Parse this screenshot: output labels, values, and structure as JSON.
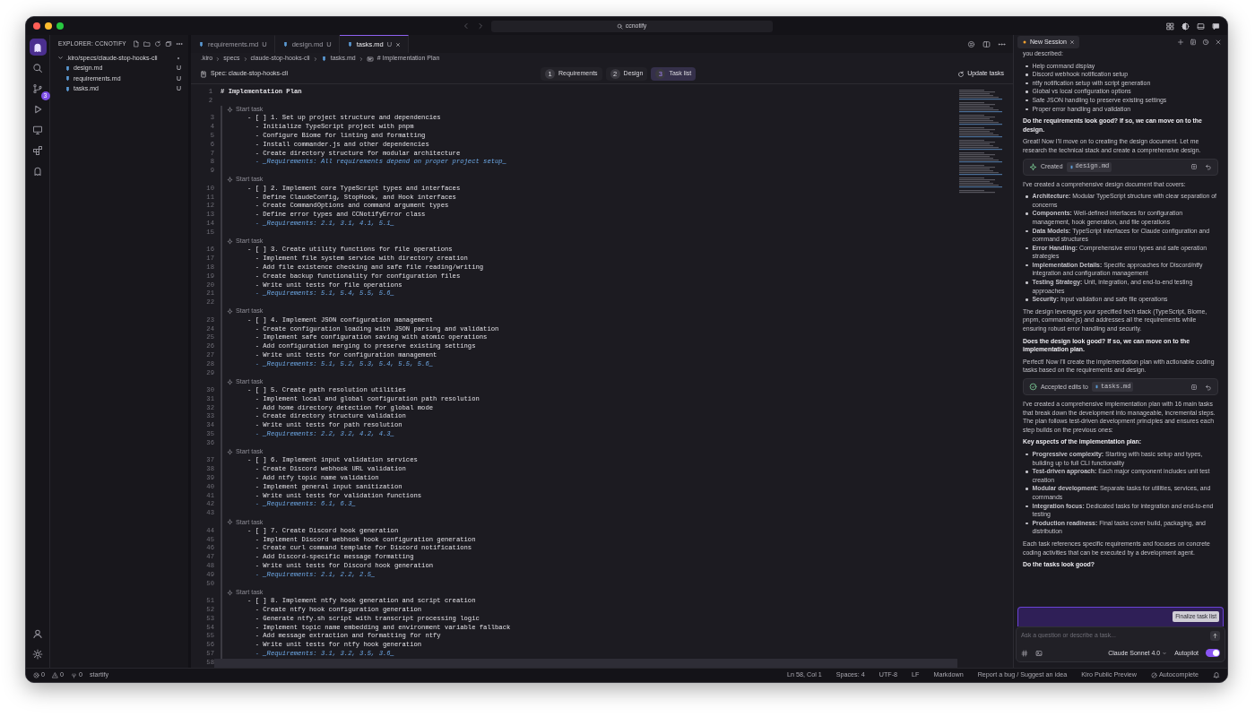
{
  "title_bar": {
    "search": "ccnotify"
  },
  "activity_bar": {
    "top": [
      {
        "kind": "logo",
        "selected": true
      },
      {
        "kind": "search",
        "selected": false
      },
      {
        "kind": "scm",
        "selected": false,
        "badge": "3"
      },
      {
        "kind": "run",
        "selected": false
      },
      {
        "kind": "remote",
        "selected": false
      },
      {
        "kind": "extensions",
        "selected": false
      },
      {
        "kind": "ghost",
        "selected": false
      }
    ],
    "bottom": [
      {
        "kind": "account",
        "selected": false
      },
      {
        "kind": "settings",
        "selected": false
      }
    ]
  },
  "explorer": {
    "title": "EXPLORER: CCNOTIFY",
    "tree": [
      {
        "label": ".kiro/specs/claude-stop-hooks-cli",
        "expanded": true,
        "changed": true,
        "children": [
          {
            "label": "design.md",
            "status": "U"
          },
          {
            "label": "requirements.md",
            "status": "U"
          },
          {
            "label": "tasks.md",
            "status": "U"
          }
        ]
      }
    ]
  },
  "editor": {
    "tabs": [
      {
        "label": "requirements.md",
        "status": "U",
        "selected": false
      },
      {
        "label": "design.md",
        "status": "U",
        "selected": false
      },
      {
        "label": "tasks.md",
        "status": "U",
        "selected": true
      }
    ],
    "breadcrumb": [
      {
        "kind": "folder",
        "text": ".kiro"
      },
      {
        "kind": "folder",
        "text": "specs"
      },
      {
        "kind": "folder",
        "text": "claude-stop-hooks-cli"
      },
      {
        "kind": "file",
        "text": "tasks.md"
      },
      {
        "kind": "symbol",
        "text": "# Implementation Plan"
      }
    ],
    "spec": "Spec: claude-stop-hooks-cli",
    "steps": [
      {
        "num": "1",
        "label": "Requirements",
        "selected": false
      },
      {
        "num": "2",
        "label": "Design",
        "selected": false
      },
      {
        "num": "3",
        "label": "Task list",
        "selected": true
      }
    ],
    "update_button": "Update tasks",
    "top_lines": [
      {
        "n": "1",
        "kind": "heading",
        "text": "# Implementation Plan",
        "current": false
      },
      {
        "n": "2",
        "kind": "blank",
        "current": false
      }
    ],
    "task_blocks": [
      {
        "lens": "Start task",
        "lines": [
          {
            "n": "3",
            "kind": "task",
            "text": "- [ ] 1. Set up project structure and dependencies",
            "current": false
          },
          {
            "n": "4",
            "kind": "item",
            "text": "  - Initialize TypeScript project with pnpm",
            "current": false
          },
          {
            "n": "5",
            "kind": "item",
            "text": "  - Configure Biome for linting and formatting",
            "current": false
          },
          {
            "n": "6",
            "kind": "item",
            "text": "  - Install commander.js and other dependencies",
            "current": false
          },
          {
            "n": "7",
            "kind": "item",
            "text": "  - Create directory structure for modular architecture",
            "current": false
          },
          {
            "n": "8",
            "kind": "req",
            "text": "  - _Requirements: All requirements depend on proper project setup_",
            "current": false
          },
          {
            "n": "9",
            "kind": "blank",
            "current": false
          }
        ]
      },
      {
        "lens": "Start task",
        "lines": [
          {
            "n": "10",
            "kind": "task",
            "text": "- [ ] 2. Implement core TypeScript types and interfaces",
            "current": false
          },
          {
            "n": "11",
            "kind": "item",
            "text": "  - Define ClaudeConfig, StopHook, and Hook interfaces",
            "current": false
          },
          {
            "n": "12",
            "kind": "item",
            "text": "  - Create CommandOptions and command argument types",
            "current": false
          },
          {
            "n": "13",
            "kind": "item",
            "text": "  - Define error types and CCNotifyError class",
            "current": false
          },
          {
            "n": "14",
            "kind": "req",
            "text": "  - _Requirements: 2.1, 3.1, 4.1, 5.1_",
            "current": false
          },
          {
            "n": "15",
            "kind": "blank",
            "current": false
          }
        ]
      },
      {
        "lens": "Start task",
        "lines": [
          {
            "n": "16",
            "kind": "task",
            "text": "- [ ] 3. Create utility functions for file operations",
            "current": false
          },
          {
            "n": "17",
            "kind": "item",
            "text": "  - Implement file system service with directory creation",
            "current": false
          },
          {
            "n": "18",
            "kind": "item",
            "text": "  - Add file existence checking and safe file reading/writing",
            "current": false
          },
          {
            "n": "19",
            "kind": "item",
            "text": "  - Create backup functionality for configuration files",
            "current": false
          },
          {
            "n": "20",
            "kind": "item",
            "text": "  - Write unit tests for file operations",
            "current": false
          },
          {
            "n": "21",
            "kind": "req",
            "text": "  - _Requirements: 5.1, 5.4, 5.5, 5.6_",
            "current": false
          },
          {
            "n": "22",
            "kind": "blank",
            "current": false
          }
        ]
      },
      {
        "lens": "Start task",
        "lines": [
          {
            "n": "23",
            "kind": "task",
            "text": "- [ ] 4. Implement JSON configuration management",
            "current": false
          },
          {
            "n": "24",
            "kind": "item",
            "text": "  - Create configuration loading with JSON parsing and validation",
            "current": false
          },
          {
            "n": "25",
            "kind": "item",
            "text": "  - Implement safe configuration saving with atomic operations",
            "current": false
          },
          {
            "n": "26",
            "kind": "item",
            "text": "  - Add configuration merging to preserve existing settings",
            "current": false
          },
          {
            "n": "27",
            "kind": "item",
            "text": "  - Write unit tests for configuration management",
            "current": false
          },
          {
            "n": "28",
            "kind": "req",
            "text": "  - _Requirements: 5.1, 5.2, 5.3, 5.4, 5.5, 5.6_",
            "current": false
          },
          {
            "n": "29",
            "kind": "blank",
            "current": false
          }
        ]
      },
      {
        "lens": "Start task",
        "lines": [
          {
            "n": "30",
            "kind": "task",
            "text": "- [ ] 5. Create path resolution utilities",
            "current": false
          },
          {
            "n": "31",
            "kind": "item",
            "text": "  - Implement local and global configuration path resolution",
            "current": false
          },
          {
            "n": "32",
            "kind": "item",
            "text": "  - Add home directory detection for global mode",
            "current": false
          },
          {
            "n": "33",
            "kind": "item",
            "text": "  - Create directory structure validation",
            "current": false
          },
          {
            "n": "34",
            "kind": "item",
            "text": "  - Write unit tests for path resolution",
            "current": false
          },
          {
            "n": "35",
            "kind": "req",
            "text": "  - _Requirements: 2.2, 3.2, 4.2, 4.3_",
            "current": false
          },
          {
            "n": "36",
            "kind": "blank",
            "current": false
          }
        ]
      },
      {
        "lens": "Start task",
        "lines": [
          {
            "n": "37",
            "kind": "task",
            "text": "- [ ] 6. Implement input validation services",
            "current": false
          },
          {
            "n": "38",
            "kind": "item",
            "text": "  - Create Discord webhook URL validation",
            "current": false
          },
          {
            "n": "39",
            "kind": "item",
            "text": "  - Add ntfy topic name validation",
            "current": false
          },
          {
            "n": "40",
            "kind": "item",
            "text": "  - Implement general input sanitization",
            "current": false
          },
          {
            "n": "41",
            "kind": "item",
            "text": "  - Write unit tests for validation functions",
            "current": false
          },
          {
            "n": "42",
            "kind": "req",
            "text": "  - _Requirements: 6.1, 6.3_",
            "current": false
          },
          {
            "n": "43",
            "kind": "blank",
            "current": false
          }
        ]
      },
      {
        "lens": "Start task",
        "lines": [
          {
            "n": "44",
            "kind": "task",
            "text": "- [ ] 7. Create Discord hook generation",
            "current": false
          },
          {
            "n": "45",
            "kind": "item",
            "text": "  - Implement Discord webhook hook configuration generation",
            "current": false
          },
          {
            "n": "46",
            "kind": "item",
            "text": "  - Create curl command template for Discord notifications",
            "current": false
          },
          {
            "n": "47",
            "kind": "item",
            "text": "  - Add Discord-specific message formatting",
            "current": false
          },
          {
            "n": "48",
            "kind": "item",
            "text": "  - Write unit tests for Discord hook generation",
            "current": false
          },
          {
            "n": "49",
            "kind": "req",
            "text": "  - _Requirements: 2.1, 2.2, 2.5_",
            "current": false
          },
          {
            "n": "50",
            "kind": "blank",
            "current": false
          }
        ]
      },
      {
        "lens": "Start task",
        "lines": [
          {
            "n": "51",
            "kind": "task",
            "text": "- [ ] 8. Implement ntfy hook generation and script creation",
            "current": false
          },
          {
            "n": "52",
            "kind": "item",
            "text": "  - Create ntfy hook configuration generation",
            "current": false
          },
          {
            "n": "53",
            "kind": "item",
            "text": "  - Generate ntfy.sh script with transcript processing logic",
            "current": false
          },
          {
            "n": "54",
            "kind": "item",
            "text": "  - Implement topic name embedding and environment variable fallback",
            "current": false
          },
          {
            "n": "55",
            "kind": "item",
            "text": "  - Add message extraction and formatting for ntfy",
            "current": false
          },
          {
            "n": "56",
            "kind": "item",
            "text": "  - Write unit tests for ntfy hook generation",
            "current": false
          },
          {
            "n": "57",
            "kind": "req",
            "text": "  - _Requirements: 3.1, 3.2, 3.5, 3.6_",
            "current": false
          },
          {
            "n": "58",
            "kind": "blank",
            "current": true
          }
        ]
      }
    ]
  },
  "chat": {
    "tabs": [
      {
        "label": "New Session",
        "selected": true
      }
    ],
    "messages": [
      {
        "kind": "text",
        "text": "you described:"
      },
      {
        "kind": "list",
        "items": [
          "Help command display",
          "Discord webhook notification setup",
          "ntfy notification setup with script generation",
          "Global vs local configuration options",
          "Safe JSON handling to preserve existing settings",
          "Proper error handling and validation"
        ]
      },
      {
        "kind": "question",
        "text": "Do the requirements look good? If so, we can move on to the design."
      },
      {
        "kind": "text",
        "text": "Great! Now I'll move on to creating the design document. Let me research the technical stack and create a comprehensive design."
      },
      {
        "kind": "file_created",
        "label": "Created",
        "file": "design.md"
      },
      {
        "kind": "text",
        "text": "I've created a comprehensive design document that covers:"
      },
      {
        "kind": "list",
        "items": [
          "**Architecture:** Modular TypeScript structure with clear separation of concerns",
          "**Components:** Well-defined interfaces for configuration management, hook generation, and file operations",
          "**Data Models:** TypeScript interfaces for Claude configuration and command structures",
          "**Error Handling:** Comprehensive error types and safe operation strategies",
          "**Implementation Details:** Specific approaches for Discord/ntfy integration and configuration management",
          "**Testing Strategy:** Unit, integration, and end-to-end testing approaches",
          "**Security:** Input validation and safe file operations"
        ]
      },
      {
        "kind": "text",
        "text": "The design leverages your specified tech stack (TypeScript, Biome, pnpm, commander.js) and addresses all the requirements while ensuring robust error handling and security."
      },
      {
        "kind": "question",
        "text": "Does the design look good? If so, we can move on to the implementation plan."
      },
      {
        "kind": "text",
        "text": "Perfect! Now I'll create the implementation plan with actionable coding tasks based on the requirements and design."
      },
      {
        "kind": "file_accepted",
        "label": "Accepted edits to",
        "file": "tasks.md"
      },
      {
        "kind": "text",
        "text": "I've created a comprehensive implementation plan with 16 main tasks that break down the development into manageable, incremental steps. The plan follows test-driven development principles and ensures each step builds on the previous ones:"
      },
      {
        "kind": "question",
        "text": "Key aspects of the implementation plan:"
      },
      {
        "kind": "list",
        "items": [
          "**Progressive complexity:** Starting with basic setup and types, building up to full CLI functionality",
          "**Test-driven approach:** Each major component includes unit test creation",
          "**Modular development:** Separate tasks for utilities, services, and commands",
          "**Integration focus:** Dedicated tasks for integration and end-to-end testing",
          "**Production readiness:** Final tasks cover build, packaging, and distribution"
        ]
      },
      {
        "kind": "text",
        "text": "Each task references specific requirements and focuses on concrete coding activities that can be executed by a development agent."
      },
      {
        "kind": "question",
        "text": "Do the tasks look good?"
      }
    ],
    "action_button": "Finalize task list",
    "composer": {
      "placeholder": "Ask a question or describe a task...",
      "model": "Claude Sonnet 4.0",
      "autopilot": {
        "label": "Autopilot",
        "on": true
      }
    }
  },
  "status_bar": {
    "left": [
      {
        "kind": "errors",
        "text": "0"
      },
      {
        "kind": "warnings",
        "text": "0"
      },
      {
        "kind": "ports",
        "text": "0"
      },
      {
        "kind": "text",
        "text": "startify"
      }
    ],
    "right": [
      {
        "kind": "text",
        "text": "Ln 58, Col 1"
      },
      {
        "kind": "text",
        "text": "Spaces: 4"
      },
      {
        "kind": "text",
        "text": "UTF-8"
      },
      {
        "kind": "text",
        "text": "LF"
      },
      {
        "kind": "text",
        "text": "Markdown"
      },
      {
        "kind": "text",
        "text": "Report a bug / Suggest an idea"
      },
      {
        "kind": "text",
        "text": "Kiro Public Preview"
      },
      {
        "kind": "autocomplete",
        "text": "Autocomplete"
      },
      {
        "kind": "bell"
      }
    ]
  }
}
